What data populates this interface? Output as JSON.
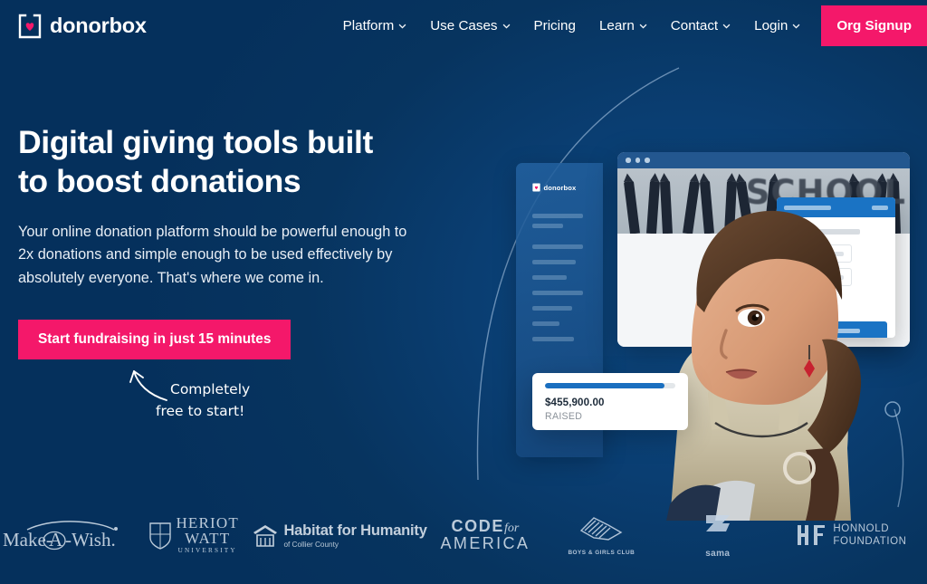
{
  "colors": {
    "background": "#05305c",
    "accent_pink": "#f4186a",
    "panel_blue": "#1a73c4",
    "text_white": "#ffffff"
  },
  "nav": {
    "logo": {
      "text": "donorbox",
      "icon": "donorbox-heart-box-logo"
    },
    "items": [
      {
        "label": "Platform",
        "has_dropdown": true
      },
      {
        "label": "Use Cases",
        "has_dropdown": true
      },
      {
        "label": "Pricing",
        "has_dropdown": false
      },
      {
        "label": "Learn",
        "has_dropdown": true
      },
      {
        "label": "Contact",
        "has_dropdown": true
      },
      {
        "label": "Login",
        "has_dropdown": true
      }
    ],
    "cta": {
      "label": "Org Signup"
    }
  },
  "hero": {
    "headline": "Digital giving tools built to boost donations",
    "subhead": "Your online donation platform should be powerful enough to 2x donations and simple enough to be used effectively by absolutely everyone. That's where we come in.",
    "cta_label": "Start fundraising in just 15 minutes",
    "annotation_line1": "Completely",
    "annotation_line2": "free to start!"
  },
  "graphic": {
    "sidebar_logo_text": "donorbox",
    "window_background_word": "SCHOOL",
    "raised_card": {
      "amount": "$455,900.00",
      "label": "RAISED",
      "progress_percent": 92
    }
  },
  "partner_logos": [
    {
      "name": "Make-A-Wish",
      "text": "Make-A-Wish."
    },
    {
      "name": "Heriot Watt University",
      "line1": "HERIOT",
      "line2": "WATT",
      "line3": "UNIVERSITY"
    },
    {
      "name": "Habitat for Humanity",
      "line1": "Habitat for Humanity",
      "line2": "of Collier County"
    },
    {
      "name": "Code for America",
      "line1": "CODE",
      "line1b": "for",
      "line2": "AMERICA"
    },
    {
      "name": "Boys & Girls Club",
      "line2": "BOYS & GIRLS CLUB"
    },
    {
      "name": "sama",
      "line2": "sama"
    },
    {
      "name": "Honnold Foundation",
      "line1": "HONNOLD",
      "line2": "FOUNDATION"
    }
  ]
}
